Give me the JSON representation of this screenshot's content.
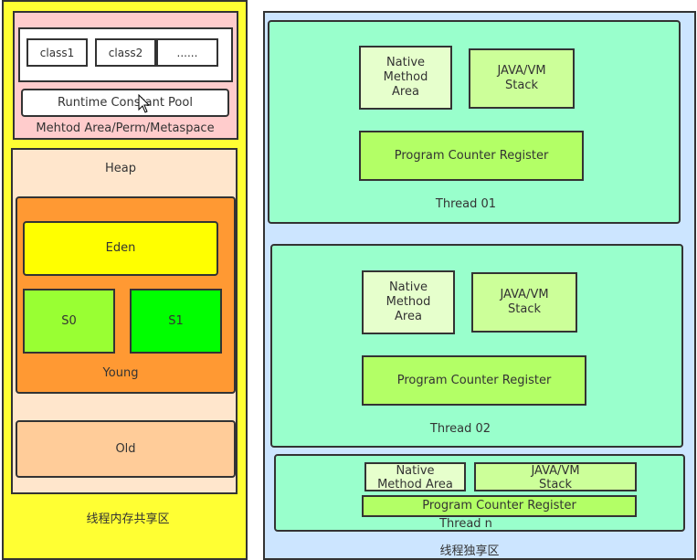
{
  "shared": {
    "label": "线程内存共享区",
    "method_area": {
      "label": "Mehtod Area/Perm/Metaspace",
      "classes": [
        "class1",
        "class2",
        "......"
      ],
      "runtime_pool": "Runtime Constant Pool"
    },
    "heap": {
      "label": "Heap",
      "young": {
        "label": "Young",
        "eden": "Eden",
        "s0": "S0",
        "s1": "S1"
      },
      "old": "Old"
    }
  },
  "private": {
    "label": "线程独享区",
    "threads": [
      {
        "label": "Thread 01",
        "native": "Native Method Area",
        "stack": "JAVA/VM Stack",
        "pcr": "Program Counter Register"
      },
      {
        "label": "Thread 02",
        "native": "Native Method Area",
        "stack": "JAVA/VM Stack",
        "pcr": "Program Counter Register"
      },
      {
        "label": "Thread n",
        "native": "Native Method Area",
        "stack": "JAVA/VM Stack",
        "pcr": "Program Counter Register"
      }
    ]
  },
  "colors": {
    "shared": "#ffff33",
    "method_area": "#ffcccc",
    "heap": "#ffe6cc",
    "young": "#ff9933",
    "eden": "#ffff00",
    "s0": "#99ff33",
    "s1": "#00ff00",
    "old": "#ffcc99",
    "private": "#cce5ff",
    "thread": "#99ffcc",
    "native": "#e6ffcc",
    "stack": "#ccff99",
    "pcr": "#b3ff66"
  }
}
